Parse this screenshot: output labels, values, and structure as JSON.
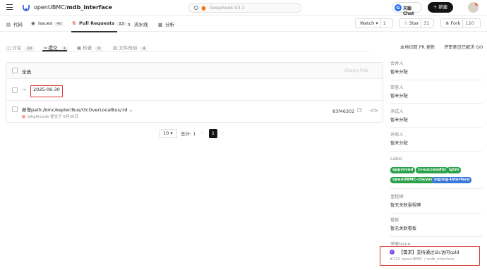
{
  "header": {
    "org": "openUBMC/",
    "repo": "mdb_interface",
    "search_placeholder": "DeepSeek-V3.1",
    "ai_chat_label": "天聪 Chat",
    "ai_chat_glyph": "G",
    "new_button": "+ 新建"
  },
  "nav": {
    "code": "代码",
    "issues": "Issues",
    "issues_count": "40",
    "pull_requests": "Pull Requests",
    "pr_count": "13",
    "pipelines": "流水线",
    "analysis": "分析",
    "watch": "Watch",
    "watch_count": "1",
    "star": "Star",
    "star_count": "31",
    "fork": "Fork",
    "fork_count": "120"
  },
  "subtabs": {
    "discussion": "讨论",
    "discussion_count": "10",
    "commits": "提交",
    "commits_count": "1",
    "checks": "检查",
    "checks_count": "0",
    "files": "文件改动",
    "files_count": "4",
    "local_pull": "本地拉取 PR 更新",
    "resolved": "评审意见已解决",
    "resolved_count": "0/0"
  },
  "commits": {
    "select_all": "全选",
    "cherry_pick": "Cherry-Pick",
    "date_group": "2025-06-30",
    "item": {
      "message": "新增path:/bmc/kepler/Bus/I3cOverLocalBus/:Id",
      "author": "bilightcode",
      "meta": "提交于 6月30日",
      "sha": "83f46302"
    }
  },
  "pagination": {
    "page_size": "10",
    "total": "总计: 1",
    "current": "1"
  },
  "sidebar": {
    "assignee_label": "合并人",
    "assignee_value": "暂未分配",
    "reviewer_label": "审查人",
    "reviewer_value": "暂未分配",
    "tester_label": "测试人",
    "tester_value": "暂未分配",
    "evaluator_label": "评审人",
    "evaluator_value": "暂未分配",
    "labels_title": "Label",
    "labels": [
      "approved",
      "ci-successful",
      "lgtm",
      "openUBMC-cla/yes",
      "sig/sig-interface"
    ],
    "milestone_label": "里程碑",
    "milestone_value": "暂无关联里程碑",
    "board_label": "看板",
    "board_value": "暂无关联看板",
    "related_issue_label": "关联Issue",
    "issue_title": "【需求】支持通过I2c访问cpld",
    "issue_meta": "#132   openUBMC / mdb_interface"
  },
  "colors": {
    "label_green": "#2aa14a",
    "label_blue": "#3a78d8",
    "highlight_red": "#d9392e",
    "primary_dark": "#141414"
  }
}
